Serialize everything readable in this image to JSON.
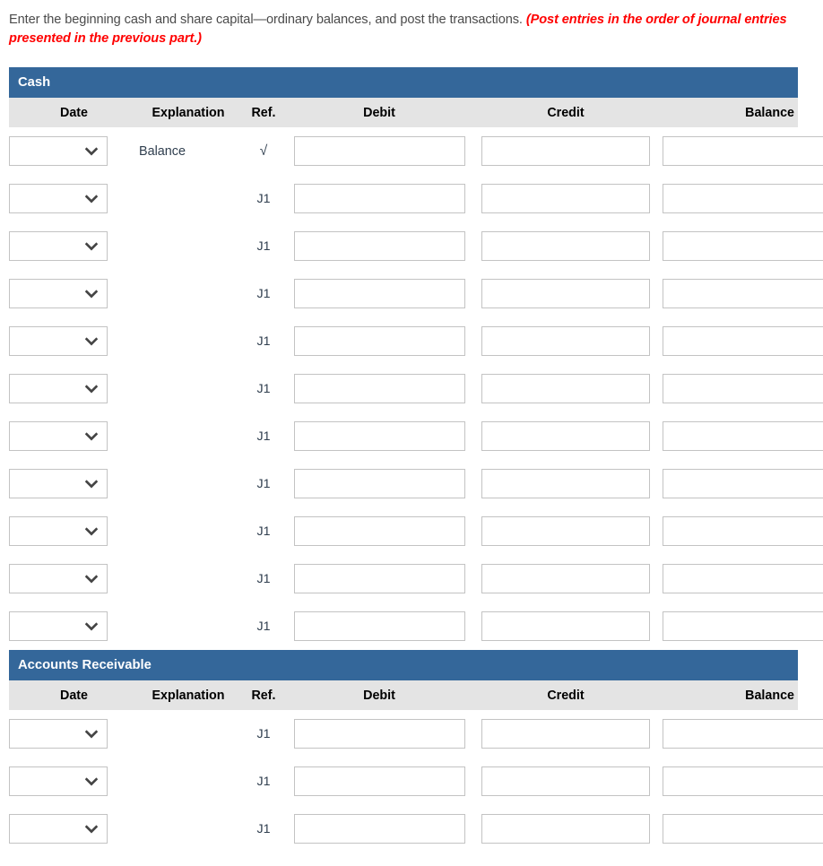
{
  "instructions": {
    "normal": "Enter the beginning cash and share capital—ordinary balances, and post the transactions. ",
    "emphasis": "(Post entries in the order of journal entries presented in the previous part.)"
  },
  "colors": {
    "header_blue": "#34679a",
    "subheader_gray": "#e4e4e4",
    "emphasis_red": "#ff0000",
    "text_slate": "#2f3e4e",
    "input_border": "#c3c3c3"
  },
  "columns": {
    "date": "Date",
    "explanation": "Explanation",
    "ref": "Ref.",
    "debit": "Debit",
    "credit": "Credit",
    "balance": "Balance"
  },
  "icons": {
    "chevron_down": "chevron-down-icon"
  },
  "ledgers": [
    {
      "title": "Cash",
      "rows": [
        {
          "date": "",
          "explanation": "Balance",
          "ref": "√",
          "debit": "",
          "credit": "",
          "balance": ""
        },
        {
          "date": "",
          "explanation": "",
          "ref": "J1",
          "debit": "",
          "credit": "",
          "balance": ""
        },
        {
          "date": "",
          "explanation": "",
          "ref": "J1",
          "debit": "",
          "credit": "",
          "balance": ""
        },
        {
          "date": "",
          "explanation": "",
          "ref": "J1",
          "debit": "",
          "credit": "",
          "balance": ""
        },
        {
          "date": "",
          "explanation": "",
          "ref": "J1",
          "debit": "",
          "credit": "",
          "balance": ""
        },
        {
          "date": "",
          "explanation": "",
          "ref": "J1",
          "debit": "",
          "credit": "",
          "balance": ""
        },
        {
          "date": "",
          "explanation": "",
          "ref": "J1",
          "debit": "",
          "credit": "",
          "balance": ""
        },
        {
          "date": "",
          "explanation": "",
          "ref": "J1",
          "debit": "",
          "credit": "",
          "balance": ""
        },
        {
          "date": "",
          "explanation": "",
          "ref": "J1",
          "debit": "",
          "credit": "",
          "balance": ""
        },
        {
          "date": "",
          "explanation": "",
          "ref": "J1",
          "debit": "",
          "credit": "",
          "balance": ""
        },
        {
          "date": "",
          "explanation": "",
          "ref": "J1",
          "debit": "",
          "credit": "",
          "balance": ""
        }
      ]
    },
    {
      "title": "Accounts Receivable",
      "rows": [
        {
          "date": "",
          "explanation": "",
          "ref": "J1",
          "debit": "",
          "credit": "",
          "balance": ""
        },
        {
          "date": "",
          "explanation": "",
          "ref": "J1",
          "debit": "",
          "credit": "",
          "balance": ""
        },
        {
          "date": "",
          "explanation": "",
          "ref": "J1",
          "debit": "",
          "credit": "",
          "balance": ""
        }
      ]
    }
  ]
}
